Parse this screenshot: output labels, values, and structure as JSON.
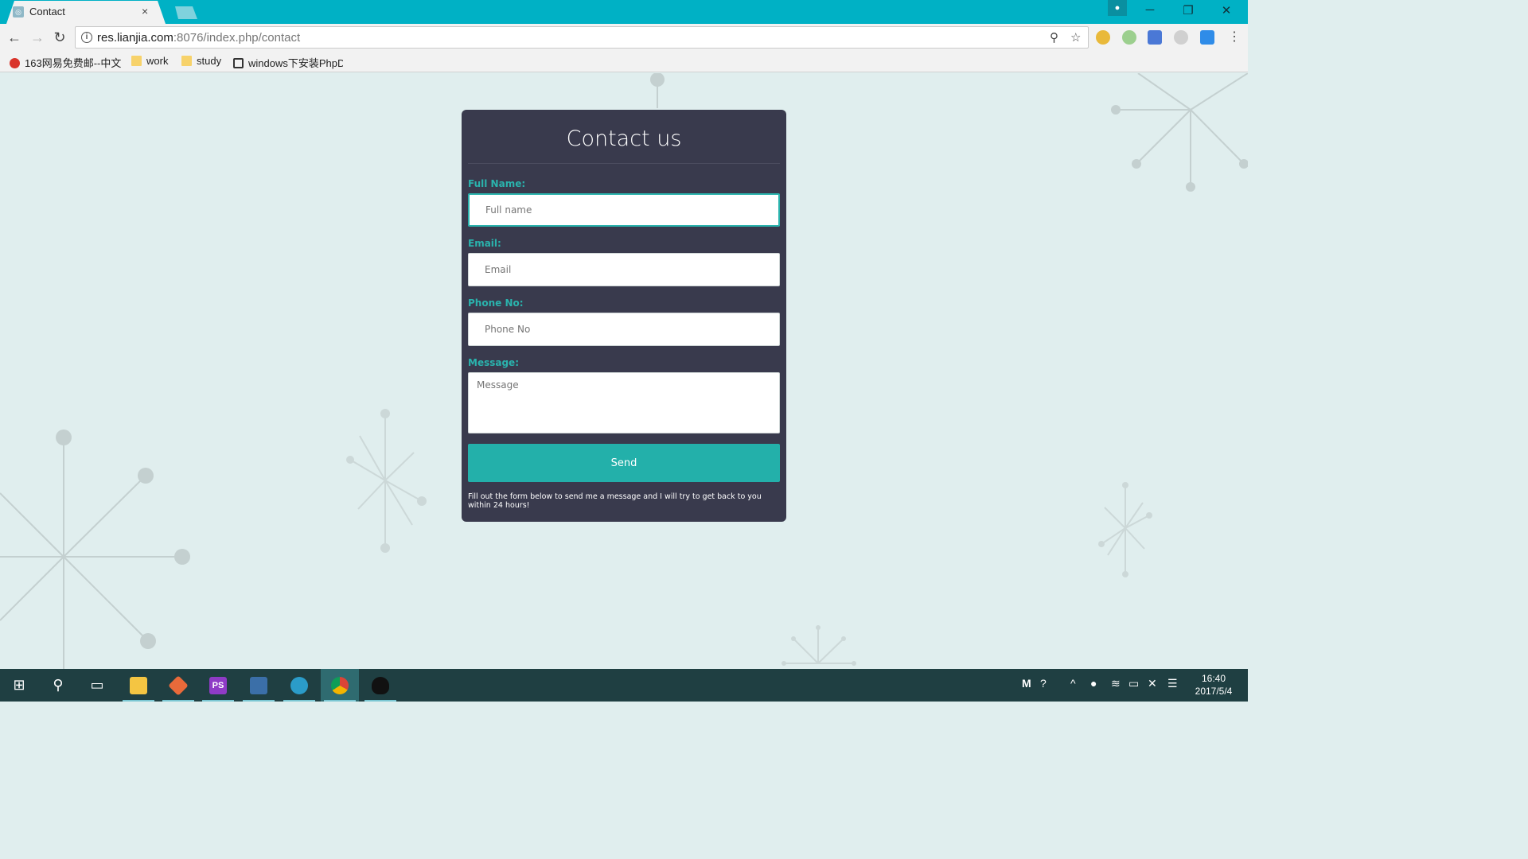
{
  "browser": {
    "tab_title": "Contact",
    "tab_close": "×",
    "url_host": "res.lianjia.com",
    "url_rest": ":8076/index.php/contact",
    "bookmarks": [
      {
        "label": "163网易免费邮--中文"
      },
      {
        "label": "work"
      },
      {
        "label": "study"
      },
      {
        "label": "windows下安装PhpD"
      }
    ],
    "window_controls": {
      "minimize": "─",
      "restore": "❐",
      "close": "✕"
    }
  },
  "form": {
    "title": "Contact us",
    "full_name_label": "Full Name:",
    "full_name_placeholder": "Full name",
    "email_label": "Email:",
    "email_placeholder": "Email",
    "phone_label": "Phone No:",
    "phone_placeholder": "Phone No",
    "message_label": "Message:",
    "message_placeholder": "Message",
    "send_label": "Send",
    "note": "Fill out the form below to send me a message and I will try to get back to you within 24 hours!"
  },
  "colors": {
    "accent": "#2ab3ad",
    "card_bg": "#393a4d",
    "page_bg": "#e0eeee",
    "titlebar": "#00b1c5"
  },
  "taskbar": {
    "time": "16:40",
    "date": "2017/5/4",
    "apps": [
      "start-icon",
      "search-icon",
      "task-view-icon",
      "file-explorer-icon",
      "git-icon",
      "phpstorm-icon",
      "visual-studio-icon",
      "network-app-icon",
      "chrome-icon",
      "qq-icon"
    ]
  }
}
